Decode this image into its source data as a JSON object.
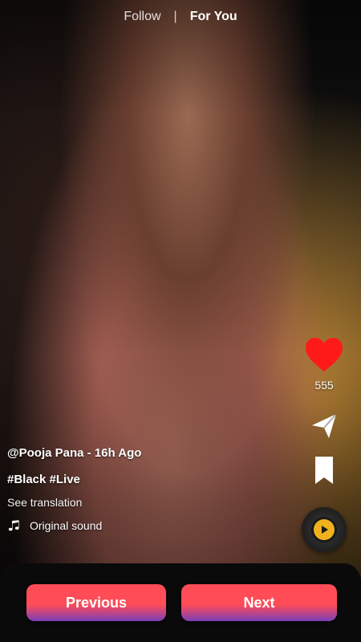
{
  "top_tabs": {
    "follow": "Follow",
    "separator": "|",
    "for_you": "For You"
  },
  "actions": {
    "like_count": "555",
    "icons": {
      "like": "heart-icon",
      "share": "send-icon",
      "save": "bookmark-icon",
      "sound": "sound-disc-icon"
    },
    "colors": {
      "heart": "#ff1a1a",
      "sound_center": "#f0b21c"
    }
  },
  "post": {
    "author_line": "@Pooja Pana - 16h Ago",
    "hashtags": "#Black #Live",
    "see_translation": "See translation",
    "sound_label": "Original sound"
  },
  "bottom_nav": {
    "previous": "Previous",
    "next": "Next",
    "button_gradient_top": "#ff4c56",
    "button_gradient_bottom": "#7b3fb8"
  }
}
